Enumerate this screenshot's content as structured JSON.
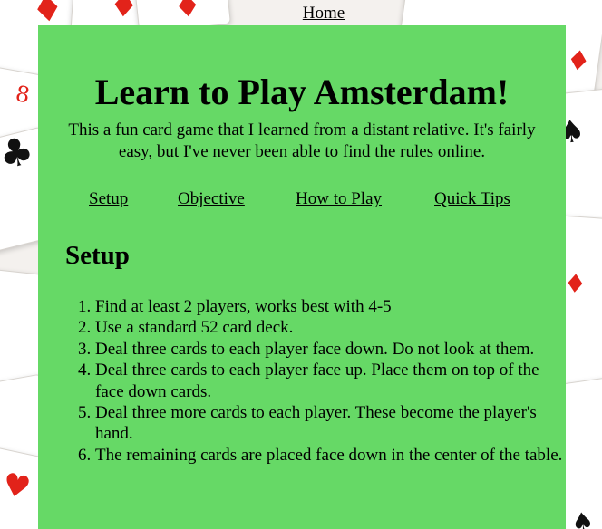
{
  "nav_top": {
    "home_label": "Home"
  },
  "page": {
    "title": "Learn to Play Amsterdam!",
    "intro": "This a fun card game that I learned from a distant relative. It's fairly easy, but I've never been able to find the rules online."
  },
  "section_nav": {
    "items": [
      {
        "label": "Setup"
      },
      {
        "label": "Objective"
      },
      {
        "label": "How to Play"
      },
      {
        "label": "Quick Tips"
      }
    ]
  },
  "setup": {
    "heading": "Setup",
    "steps": [
      "Find at least 2 players, works best with 4-5",
      "Use a standard 52 card deck.",
      "Deal three cards to each player face down. Do not look at them.",
      "Deal three cards to each player face up. Place them on top of the face down cards.",
      "Deal three more cards to each player. These become the player's hand.",
      "The remaining cards are placed face down in the center of the table."
    ]
  },
  "colors": {
    "panel_background": "#66d966",
    "card_red": "#e2231a",
    "card_black": "#111111"
  },
  "background": {
    "description_icons": [
      "diamond-icon",
      "club-icon",
      "heart-icon",
      "spade-icon"
    ],
    "card_indices": [
      "8"
    ]
  }
}
